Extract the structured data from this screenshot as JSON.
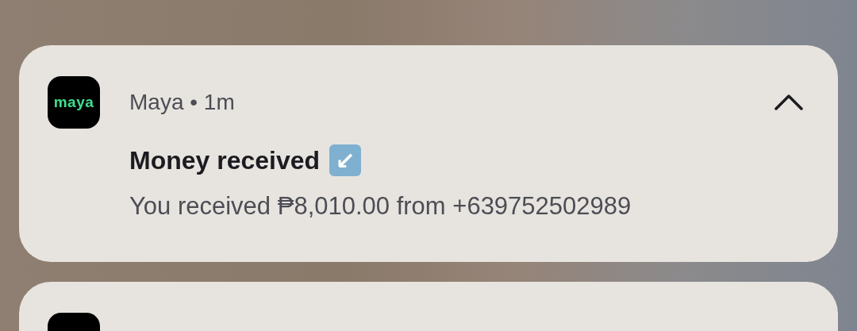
{
  "notification": {
    "app_icon_text": "maya",
    "app_name": "Maya",
    "separator": "•",
    "time": "1m",
    "expanded": true,
    "title": "Money received",
    "title_badge": "↙",
    "body": "You received ₱8,010.00 from +639752502989"
  }
}
